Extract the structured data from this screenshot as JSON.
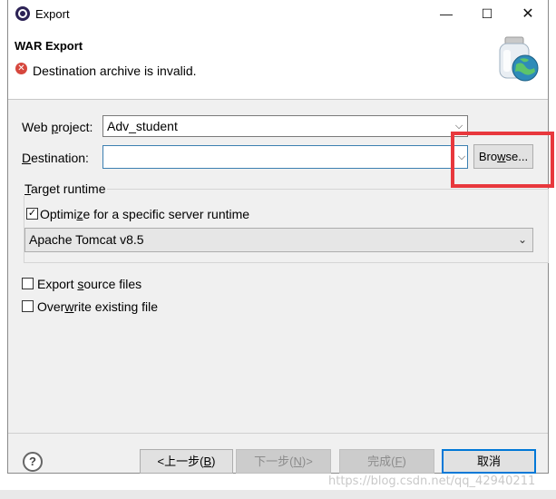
{
  "window": {
    "title": "Export",
    "minimize_glyph": "—",
    "maximize_glyph": "☐",
    "close_glyph": "✕"
  },
  "header": {
    "title": "WAR Export",
    "message": "Destination archive is invalid.",
    "error_icon_glyph": "✕",
    "message_icon": "error-icon",
    "banner_icon": "war-export-jar-globe-icon"
  },
  "form": {
    "web_project": {
      "label_pre": "Web ",
      "label_ul": "p",
      "label_post": "roject:",
      "value": "Adv_student"
    },
    "destination": {
      "label_ul": "D",
      "label_post": "estination:",
      "value": ""
    },
    "browse_button": {
      "pre": "Bro",
      "ul": "w",
      "post": "se..."
    }
  },
  "runtime_group": {
    "title_ul": "T",
    "title_post": "arget runtime",
    "optimize": {
      "checked": true,
      "pre": "Optimi",
      "ul": "z",
      "post": "e for a specific server runtime"
    },
    "server_runtime": "Apache Tomcat v8.5"
  },
  "options": {
    "export_source": {
      "checked": false,
      "pre": "Export ",
      "ul": "s",
      "post": "ource files"
    },
    "overwrite": {
      "checked": false,
      "pre": "Over",
      "ul": "w",
      "post": "rite existing file"
    }
  },
  "buttons": {
    "back": {
      "pre": "<上一步(",
      "ul": "B",
      "post": ")"
    },
    "next": {
      "pre": "下一步(",
      "ul": "N",
      "post": ")>"
    },
    "finish": {
      "pre": "完成(",
      "ul": "F",
      "post": ")"
    },
    "cancel": "取消"
  },
  "help_glyph": "?",
  "watermark": "https://blog.csdn.net/qq_42940211",
  "colors": {
    "dialog_bg": "#f0f0f0",
    "highlight_box": "#e8383d",
    "error_icon": "#d6473d",
    "focus_border": "#3c7fb1",
    "default_button_border": "#0078d7"
  }
}
